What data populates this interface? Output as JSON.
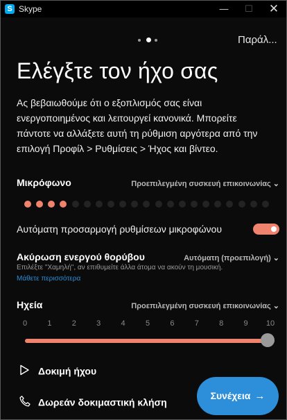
{
  "window": {
    "app_name": "Skype",
    "app_icon_letter": "S",
    "minimize_glyph": "—",
    "maximize_glyph": "☐",
    "close_glyph": "✕"
  },
  "pager": {
    "total": 3,
    "active_index": 1
  },
  "header": {
    "skip_label": "Παράλ..."
  },
  "page": {
    "title": "Ελέγξτε τον ήχο σας",
    "description": "Ας βεβαιωθούμε ότι ο εξοπλισμός σας είναι ενεργοποιημένος και λειτουργεί κανονικά. Μπορείτε πάντοτε να αλλάξετε αυτή τη ρύθμιση αργότερα από την επιλογή Προφίλ > Ρυθμίσεις > Ήχος και βίντεο."
  },
  "microphone": {
    "label": "Μικρόφωνο",
    "device": "Προεπιλεγμένη συσκευή επικοινωνίας",
    "level_segments_total": 21,
    "level_segments_active": 4
  },
  "auto_adjust": {
    "label": "Αυτόματη προσαρμογή ρυθμίσεων μικροφώνου",
    "enabled": true
  },
  "noise": {
    "label": "Ακύρωση ενεργού θορύβου",
    "value": "Αυτόματη (προεπιλογή)",
    "hint": "Επιλέξτε \"Χαμηλή\", αν επιθυμείτε άλλα άτομα να ακούν τη μουσική.",
    "learn_more": "Μάθετε περισσότερα"
  },
  "speakers": {
    "label": "Ηχεία",
    "device": "Προεπιλεγμένη συσκευή επικοινωνίας",
    "scale": [
      "0",
      "1",
      "2",
      "3",
      "4",
      "5",
      "6",
      "7",
      "8",
      "9",
      "10"
    ],
    "volume": 10
  },
  "actions": {
    "test_audio": "Δοκιμή ήχου",
    "free_test_call": "Δωρεάν δοκιμαστική κλήση",
    "continue": "Συνέχεια",
    "continue_arrow": "→"
  },
  "colors": {
    "accent": "#f0836e",
    "primary_button": "#2d8fd9",
    "link": "#2a8ed8",
    "background": "#0b0b0b"
  }
}
